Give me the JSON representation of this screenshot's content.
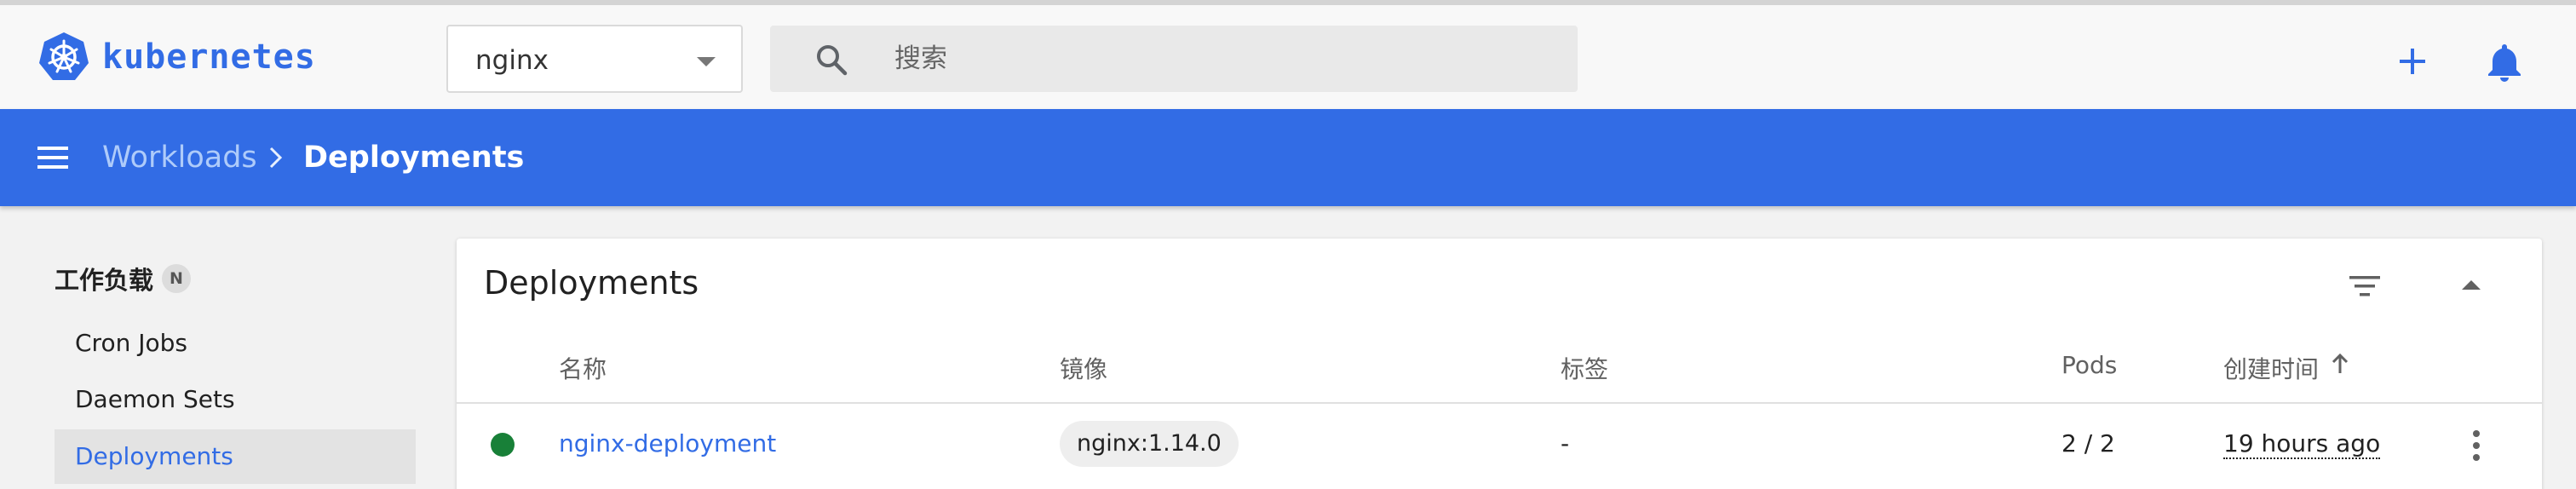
{
  "header": {
    "brand": "kubernetes",
    "namespace": "nginx",
    "search_placeholder": "搜索",
    "accent": "#326ce5"
  },
  "breadcrumb": {
    "parent": "Workloads",
    "current": "Deployments"
  },
  "sidebar": {
    "title": "工作负载",
    "badge": "N",
    "items": [
      {
        "label": "Cron Jobs",
        "active": false
      },
      {
        "label": "Daemon Sets",
        "active": false
      },
      {
        "label": "Deployments",
        "active": true
      }
    ]
  },
  "card": {
    "title": "Deployments",
    "columns": [
      "名称",
      "镜像",
      "标签",
      "Pods",
      "创建时间"
    ],
    "sort_column": "创建时间",
    "sort_direction": "ascending",
    "rows": [
      {
        "status": "running",
        "status_color": "#188038",
        "name": "nginx-deployment",
        "image": "nginx:1.14.0",
        "labels": "-",
        "pods": "2 / 2",
        "created": "19 hours ago"
      }
    ]
  }
}
